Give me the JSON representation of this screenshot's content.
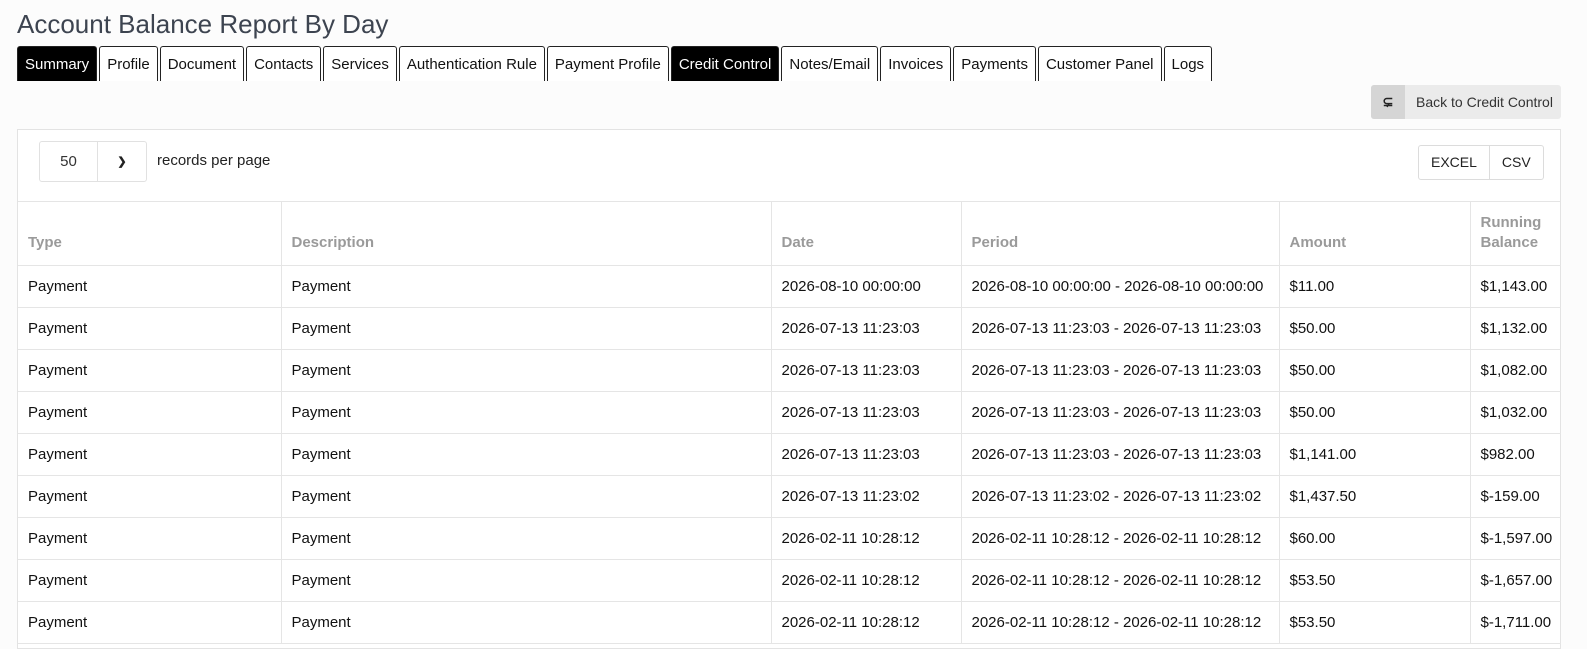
{
  "page_title": "Account Balance Report By Day",
  "tabs": [
    {
      "label": "Summary",
      "active": true
    },
    {
      "label": "Profile",
      "active": false
    },
    {
      "label": "Document",
      "active": false
    },
    {
      "label": "Contacts",
      "active": false
    },
    {
      "label": "Services",
      "active": false
    },
    {
      "label": "Authentication Rule",
      "active": false
    },
    {
      "label": "Payment Profile",
      "active": false
    },
    {
      "label": "Credit Control",
      "active": true
    },
    {
      "label": "Notes/Email",
      "active": false
    },
    {
      "label": "Invoices",
      "active": false
    },
    {
      "label": "Payments",
      "active": false
    },
    {
      "label": "Customer Panel",
      "active": false
    },
    {
      "label": "Logs",
      "active": false
    }
  ],
  "back_button": {
    "icon": "back-arrow-icon",
    "label": "Back to Credit Control"
  },
  "records_per_page": {
    "value": "50",
    "label": "records per page"
  },
  "export": {
    "excel": "EXCEL",
    "csv": "CSV"
  },
  "table": {
    "columns": [
      "Type",
      "Description",
      "Date",
      "Period",
      "Amount",
      "Running Balance"
    ],
    "rows": [
      [
        "Payment",
        "Payment",
        "2026-08-10 00:00:00",
        "2026-08-10 00:00:00 - 2026-08-10 00:00:00",
        "$11.00",
        "$1,143.00"
      ],
      [
        "Payment",
        "Payment",
        "2026-07-13 11:23:03",
        "2026-07-13 11:23:03 - 2026-07-13 11:23:03",
        "$50.00",
        "$1,132.00"
      ],
      [
        "Payment",
        "Payment",
        "2026-07-13 11:23:03",
        "2026-07-13 11:23:03 - 2026-07-13 11:23:03",
        "$50.00",
        "$1,082.00"
      ],
      [
        "Payment",
        "Payment",
        "2026-07-13 11:23:03",
        "2026-07-13 11:23:03 - 2026-07-13 11:23:03",
        "$50.00",
        "$1,032.00"
      ],
      [
        "Payment",
        "Payment",
        "2026-07-13 11:23:03",
        "2026-07-13 11:23:03 - 2026-07-13 11:23:03",
        "$1,141.00",
        "$982.00"
      ],
      [
        "Payment",
        "Payment",
        "2026-07-13 11:23:02",
        "2026-07-13 11:23:02 - 2026-07-13 11:23:02",
        "$1,437.50",
        "$-159.00"
      ],
      [
        "Payment",
        "Payment",
        "2026-02-11 10:28:12",
        "2026-02-11 10:28:12 - 2026-02-11 10:28:12",
        "$60.00",
        "$-1,597.00"
      ],
      [
        "Payment",
        "Payment",
        "2026-02-11 10:28:12",
        "2026-02-11 10:28:12 - 2026-02-11 10:28:12",
        "$53.50",
        "$-1,657.00"
      ],
      [
        "Payment",
        "Payment",
        "2026-02-11 10:28:12",
        "2026-02-11 10:28:12 - 2026-02-11 10:28:12",
        "$53.50",
        "$-1,711.00"
      ]
    ]
  }
}
